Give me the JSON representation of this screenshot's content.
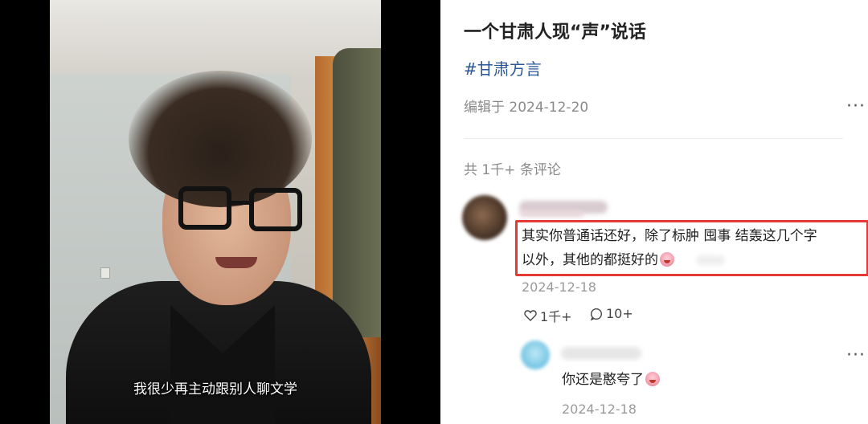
{
  "video": {
    "subtitle": "我很少再主动跟别人聊文学"
  },
  "post": {
    "title": "一个甘肃人现“声”说话",
    "hashtag": "#甘肃方言",
    "edited": "编辑于 2024-12-20",
    "more_label": "···",
    "comment_count": "共 1千+ 条评论"
  },
  "comments": [
    {
      "text_line1": "其实你普通话还好，除了标肿 囤事 结轰这几个字",
      "text_line2": "以外，其他的都挺好的",
      "date": "2024-12-18",
      "likes": "1千+",
      "replies": "10+",
      "more_label": "···"
    }
  ],
  "reply": {
    "text": "你还是憨夸了",
    "date": "2024-12-18",
    "more_label": "···"
  },
  "colors": {
    "hashtag": "#2b5797",
    "highlight": "#e53935",
    "muted": "#8a8a8a"
  },
  "icons": [
    "heart-icon",
    "comment-bubble-icon",
    "more-icon",
    "emoji-icon"
  ]
}
